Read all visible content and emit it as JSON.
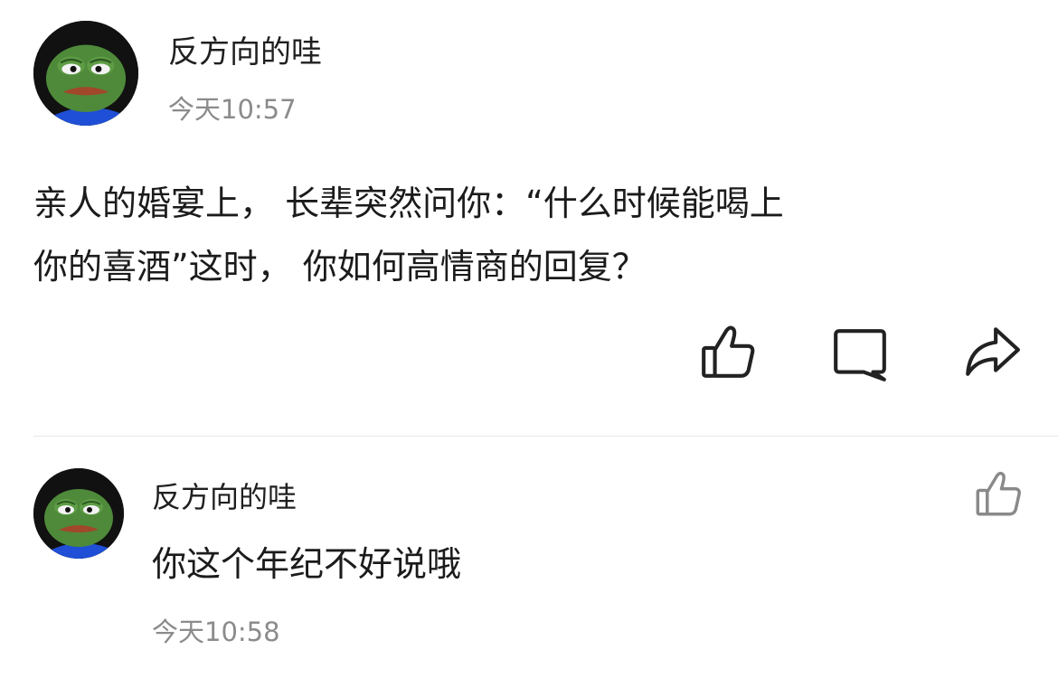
{
  "post": {
    "username": "反方向的哇",
    "timestamp": "今天10:57",
    "text_line1": "亲人的婚宴上， 长辈突然问你：“什么时候能喝上",
    "text_line2": "你的喜酒”这时， 你如何高情商的回复？"
  },
  "actions": [
    {
      "icon": "thumbs-up-icon"
    },
    {
      "icon": "comment-icon"
    },
    {
      "icon": "share-icon"
    }
  ],
  "comment": {
    "username": "反方向的哇",
    "text": "你这个年纪不好说哦",
    "timestamp": "今天10:58",
    "like_icon": "thumbs-up-icon"
  },
  "colors": {
    "text": "#1b1b1b",
    "muted": "#8b8b8b",
    "icon": "#222222",
    "icon_muted": "#8a8a8a",
    "divider": "#e6e6e6"
  }
}
